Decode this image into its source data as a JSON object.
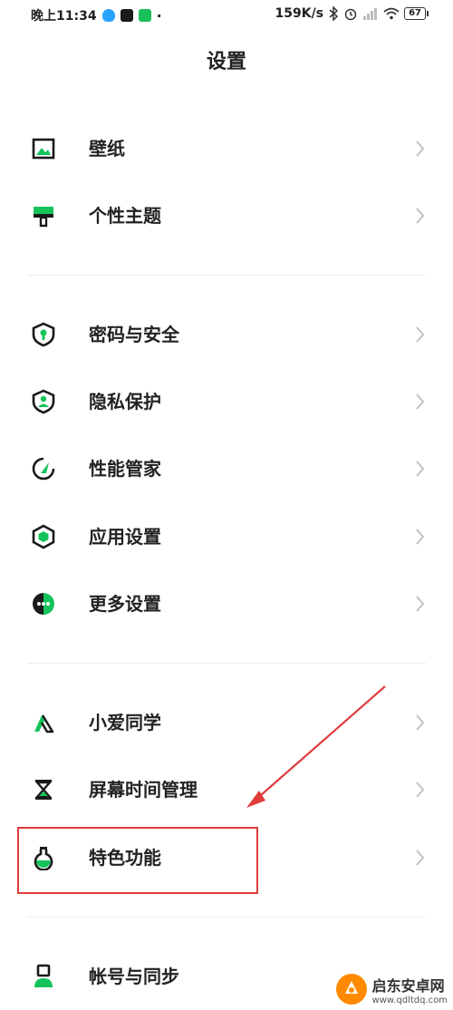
{
  "status_bar": {
    "time": "晚上11:34",
    "net_speed": "159K/s",
    "battery": "67"
  },
  "page": {
    "title": "设置"
  },
  "items": [
    {
      "label": "壁纸",
      "icon": "wallpaper-icon"
    },
    {
      "label": "个性主题",
      "icon": "theme-icon"
    },
    {
      "label": "密码与安全",
      "icon": "security-shield-icon"
    },
    {
      "label": "隐私保护",
      "icon": "privacy-shield-icon"
    },
    {
      "label": "性能管家",
      "icon": "performance-icon"
    },
    {
      "label": "应用设置",
      "icon": "app-settings-icon"
    },
    {
      "label": "更多设置",
      "icon": "more-settings-icon"
    },
    {
      "label": "小爱同学",
      "icon": "xiaoai-icon"
    },
    {
      "label": "屏幕时间管理",
      "icon": "hourglass-icon"
    },
    {
      "label": "特色功能",
      "icon": "flask-icon"
    },
    {
      "label": "帐号与同步",
      "icon": "account-icon"
    }
  ],
  "watermark": {
    "name": "启东安卓网",
    "url": "www.qdltdq.com"
  },
  "colors": {
    "accent": "#14c35a",
    "dark": "#1a1a1a",
    "annotation": "#e03c3c"
  }
}
